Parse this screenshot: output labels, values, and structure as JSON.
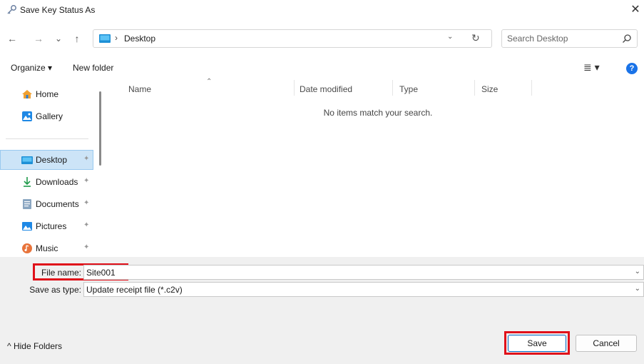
{
  "window": {
    "title": "Save Key Status As",
    "close_label": "✕"
  },
  "nav": {
    "back_icon": "←",
    "forward_icon": "→",
    "recent_icon": "⌄",
    "up_icon": "↑",
    "breadcrumb_sep": "›",
    "breadcrumb": "Desktop",
    "addr_dropdown_icon": "⌄",
    "refresh_icon": "↻",
    "search_placeholder": "Search Desktop"
  },
  "toolbar": {
    "organize": "Organize ▾",
    "new_folder": "New folder",
    "view_icon": "≣ ▾",
    "help": "?"
  },
  "sidebar": {
    "items": [
      {
        "label": "Home",
        "pinned": false
      },
      {
        "label": "Gallery",
        "pinned": false
      },
      {
        "label": "Desktop",
        "pinned": true,
        "selected": true
      },
      {
        "label": "Downloads",
        "pinned": true
      },
      {
        "label": "Documents",
        "pinned": true
      },
      {
        "label": "Pictures",
        "pinned": true
      },
      {
        "label": "Music",
        "pinned": true
      }
    ],
    "pin_glyph": "📌"
  },
  "filelist": {
    "columns": [
      "Name",
      "Date modified",
      "Type",
      "Size"
    ],
    "empty_message": "No items match your search."
  },
  "form": {
    "filename_label": "File name:",
    "filename_value": "Site001",
    "savetype_label": "Save as type:",
    "savetype_value": "Update receipt file (*.c2v)"
  },
  "footer": {
    "hide_folders": "^  Hide Folders",
    "save": "Save",
    "cancel": "Cancel"
  },
  "colors": {
    "accent": "#0067c0",
    "highlight": "#e0101a",
    "selected_bg": "#cce4f7"
  }
}
